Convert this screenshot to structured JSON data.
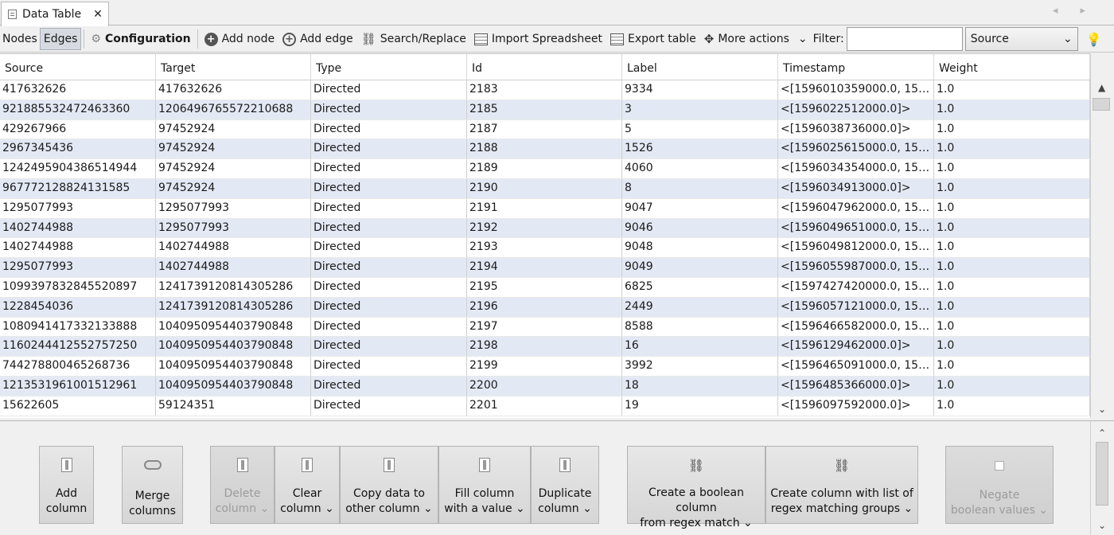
{
  "tab": {
    "label": "Data Table",
    "close": "✕"
  },
  "nav": {
    "arrows": "◂ ▸"
  },
  "toolbar": {
    "nodes": "Nodes",
    "edges": "Edges",
    "configuration": "Configuration",
    "add_node": "Add node",
    "add_edge": "Add edge",
    "search_replace": "Search/Replace",
    "import_spreadsheet": "Import Spreadsheet",
    "export_table": "Export table",
    "more_actions": "More actions",
    "filter_label": "Filter:",
    "filter_value": "",
    "filter_column": "Source"
  },
  "table": {
    "columns": [
      "Source",
      "Target",
      "Type",
      "Id",
      "Label",
      "Timestamp",
      "Weight"
    ],
    "rows": [
      [
        "417632626",
        "417632626",
        "Directed",
        "2183",
        "9334",
        "<[1596010359000.0, 159…",
        "1.0"
      ],
      [
        "921885532472463360",
        "1206496765572210688",
        "Directed",
        "2185",
        "3",
        "<[1596022512000.0]>",
        "1.0"
      ],
      [
        "429267966",
        "97452924",
        "Directed",
        "2187",
        "5",
        "<[1596038736000.0]>",
        "1.0"
      ],
      [
        "2967345436",
        "97452924",
        "Directed",
        "2188",
        "1526",
        "<[1596025615000.0, 159…",
        "1.0"
      ],
      [
        "1242495904386514944",
        "97452924",
        "Directed",
        "2189",
        "4060",
        "<[1596034354000.0, 159…",
        "1.0"
      ],
      [
        "967772128824131585",
        "97452924",
        "Directed",
        "2190",
        "8",
        "<[1596034913000.0]>",
        "1.0"
      ],
      [
        "1295077993",
        "1295077993",
        "Directed",
        "2191",
        "9047",
        "<[1596047962000.0, 159…",
        "1.0"
      ],
      [
        "1402744988",
        "1295077993",
        "Directed",
        "2192",
        "9046",
        "<[1596049651000.0, 159…",
        "1.0"
      ],
      [
        "1402744988",
        "1402744988",
        "Directed",
        "2193",
        "9048",
        "<[1596049812000.0, 159…",
        "1.0"
      ],
      [
        "1295077993",
        "1402744988",
        "Directed",
        "2194",
        "9049",
        "<[1596055987000.0, 159…",
        "1.0"
      ],
      [
        "1099397832845520897",
        "1241739120814305286",
        "Directed",
        "2195",
        "6825",
        "<[1597427420000.0, 159…",
        "1.0"
      ],
      [
        "1228454036",
        "1241739120814305286",
        "Directed",
        "2196",
        "2449",
        "<[1596057121000.0, 159…",
        "1.0"
      ],
      [
        "1080941417332133888",
        "1040950954403790848",
        "Directed",
        "2197",
        "8588",
        "<[1596466582000.0, 159…",
        "1.0"
      ],
      [
        "1160244412552757250",
        "1040950954403790848",
        "Directed",
        "2198",
        "16",
        "<[1596129462000.0]>",
        "1.0"
      ],
      [
        "744278800465268736",
        "1040950954403790848",
        "Directed",
        "2199",
        "3992",
        "<[1596465091000.0, 159…",
        "1.0"
      ],
      [
        "1213531961001512961",
        "1040950954403790848",
        "Directed",
        "2200",
        "18",
        "<[1596485366000.0]>",
        "1.0"
      ],
      [
        "15622605",
        "59124351",
        "Directed",
        "2201",
        "19",
        "<[1596097592000.0]>",
        "1.0"
      ]
    ]
  },
  "manipulators": [
    {
      "line1": "Add",
      "line2": "column",
      "icon": "column-icon",
      "disabled": false
    },
    {
      "line1": "Merge",
      "line2": "columns",
      "icon": "merge-icon",
      "disabled": false
    },
    {
      "line1": "Delete",
      "line2": "column ⌄",
      "icon": "column-icon",
      "disabled": true
    },
    {
      "line1": "Clear",
      "line2": "column ⌄",
      "icon": "column-icon",
      "disabled": false
    },
    {
      "line1": "Copy data to",
      "line2": "other column ⌄",
      "icon": "column-icon",
      "disabled": false
    },
    {
      "line1": "Fill column",
      "line2": "with a value ⌄",
      "icon": "column-icon",
      "disabled": false
    },
    {
      "line1": "Duplicate",
      "line2": "column ⌄",
      "icon": "column-icon",
      "disabled": false
    },
    {
      "line1": "Create a boolean column",
      "line2": "from regex match ⌄",
      "icon": "binoculars-icon",
      "disabled": false
    },
    {
      "line1": "Create column with list of",
      "line2": "regex matching groups ⌄",
      "icon": "binoculars-icon",
      "disabled": false
    },
    {
      "line1": "Negate",
      "line2": "boolean values ⌄",
      "icon": "negate-icon",
      "disabled": true
    }
  ]
}
